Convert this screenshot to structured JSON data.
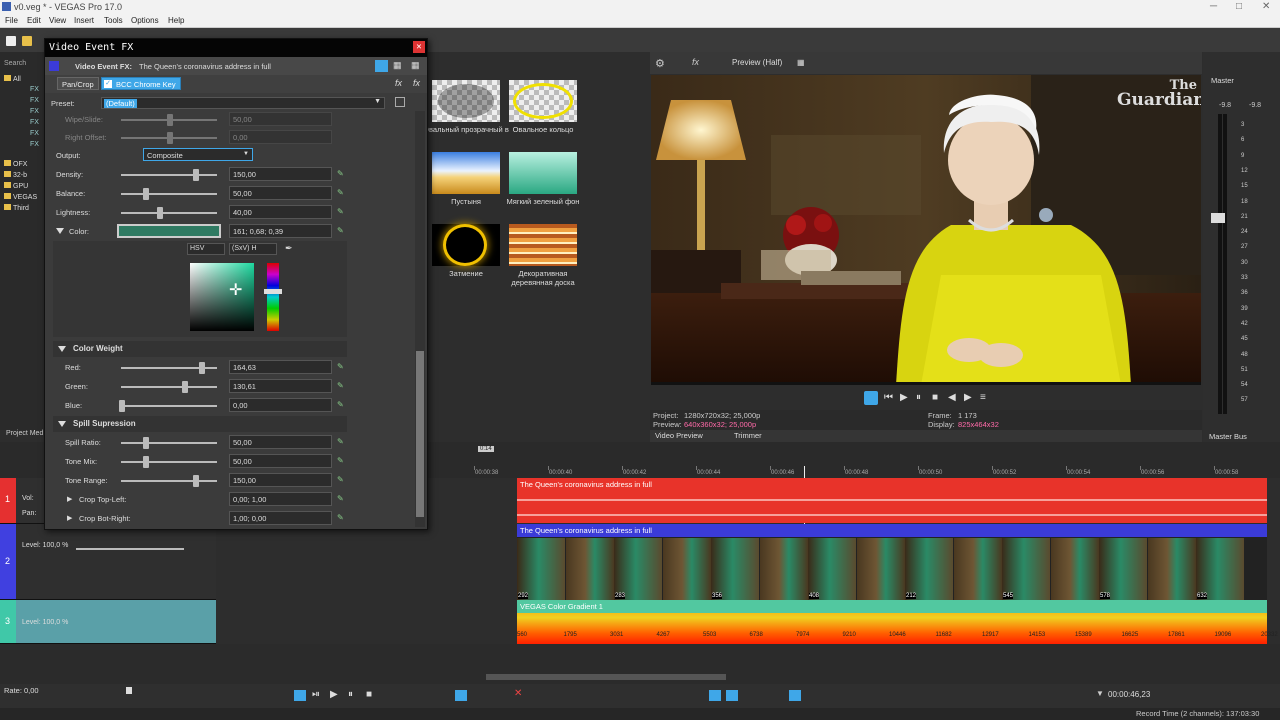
{
  "app": {
    "title": "v0.veg * - VEGAS Pro 17.0",
    "menu": [
      "File",
      "Edit",
      "View",
      "Insert",
      "Tools",
      "Options",
      "Help"
    ]
  },
  "explorer": {
    "search_placeholder": "Search",
    "items": [
      "All",
      "FX",
      "FX",
      "FX",
      "FX",
      "FX",
      "FX",
      "OFX",
      "32-b",
      "GPU",
      "VEGAS",
      "Third"
    ]
  },
  "fx_window": {
    "title": "Video Event FX",
    "header_label": "Video Event FX:",
    "event_name": "The Queen's coronavirus address in full",
    "chain": [
      "Pan/Crop",
      "BCC Chrome Key"
    ],
    "preset_label": "Preset:",
    "preset_value": "(Default)",
    "params": [
      {
        "label": "Wipe/Slide:",
        "value": "50,00"
      },
      {
        "label": "Right Offset:",
        "value": "0,00"
      },
      {
        "label": "Output:",
        "value": "Composite"
      },
      {
        "label": "Density:",
        "value": "150,00"
      },
      {
        "label": "Balance:",
        "value": "50,00"
      },
      {
        "label": "Lightness:",
        "value": "40,00"
      },
      {
        "label": "Color:",
        "value": "161; 0,68; 0,39"
      }
    ],
    "color_mode": "HSV",
    "color_model": "(SxV) H",
    "color_weight_title": "Color Weight",
    "color_weight": [
      {
        "label": "Red:",
        "value": "164,63"
      },
      {
        "label": "Green:",
        "value": "130,61"
      },
      {
        "label": "Blue:",
        "value": "0,00"
      }
    ],
    "spill_title": "Spill Supression",
    "spill": [
      {
        "label": "Spill Ratio:",
        "value": "50,00"
      },
      {
        "label": "Tone Mix:",
        "value": "50,00"
      },
      {
        "label": "Tone Range:",
        "value": "150,00"
      },
      {
        "label": "Crop Top-Left:",
        "value": "0,00; 1,00"
      },
      {
        "label": "Crop Bot-Right:",
        "value": "1,00; 0,00"
      }
    ]
  },
  "generators": [
    {
      "caption": "Овальный прозрачный в"
    },
    {
      "caption": "Овальное кольцо"
    },
    {
      "caption": "Пустыня"
    },
    {
      "caption": "Мягкий зеленый фон"
    },
    {
      "caption": "Затмение"
    },
    {
      "caption": "Декоративная деревянная доска"
    }
  ],
  "preview": {
    "mode": "Preview (Half)",
    "watermark_line1": "The",
    "watermark_line2": "Guardian",
    "project_label": "Project:",
    "project_value": "1280x720x32; 25,000p",
    "preview_label": "Preview:",
    "preview_value": "640x360x32; 25,000p",
    "frame_label": "Frame:",
    "frame_value": "1 173",
    "display_label": "Display:",
    "display_value": "825x464x32",
    "tabs": [
      "Video Preview",
      "Trimmer"
    ]
  },
  "master": {
    "label": "Master",
    "peak_left": "-9.8",
    "peak_right": "-9.8",
    "scale": [
      "3",
      "6",
      "9",
      "12",
      "15",
      "18",
      "21",
      "24",
      "27",
      "30",
      "33",
      "36",
      "39",
      "42",
      "45",
      "48",
      "51",
      "54",
      "57"
    ],
    "bus_label": "Master Bus"
  },
  "timeline": {
    "project_media_tab": "Project Med",
    "region_marker": "0:14",
    "ticks": [
      "00:00:38",
      "00:00:40",
      "00:00:42",
      "00:00:44",
      "00:00:46",
      "00:00:48",
      "00:00:50",
      "00:00:52",
      "00:00:54",
      "00:00:56",
      "00:00:58"
    ],
    "audio_track": {
      "num": "1",
      "vol_label": "Vol:",
      "pan_label": "Pan:",
      "clip_title": "The Queen's coronavirus address in full"
    },
    "video_track": {
      "num": "2",
      "level": "Level: 100,0 %",
      "clip_title": "The Queen's coronavirus address in full",
      "frame_numbers": [
        "292",
        "283",
        "356",
        "408",
        "212",
        "545",
        "578",
        "632"
      ]
    },
    "gradient_track": {
      "num": "3",
      "level": "Level: 100,0 %",
      "clip_title": "VEGAS Color Gradient 1",
      "frame_numbers": [
        "560",
        "1795",
        "3031",
        "4267",
        "5503",
        "6738",
        "7974",
        "9210",
        "10446",
        "11682",
        "12917",
        "14153",
        "15389",
        "16625",
        "17861",
        "19096",
        "20332"
      ]
    }
  },
  "transport": {
    "rate": "Rate: 0,00",
    "timecode": "00:00:46,23"
  },
  "status": {
    "record_time": "Record Time (2 channels): 137:03:30"
  },
  "colors": {
    "accent": "#3fa7e8",
    "audio_clip": "#e8332a",
    "video_header": "#3b3bd8",
    "gradient_header": "#52c8a0",
    "track1": "#e53030",
    "track2": "#4040e0",
    "track3": "#40c8a8"
  }
}
